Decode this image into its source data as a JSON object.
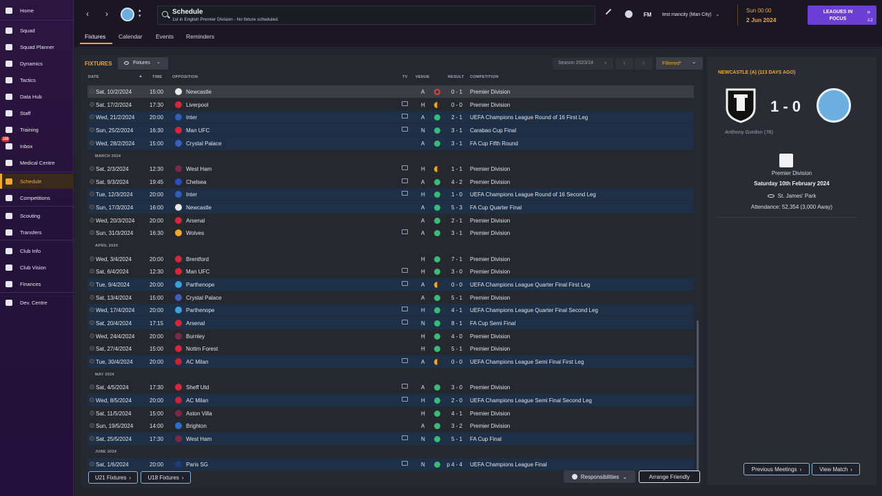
{
  "sidebar": {
    "items": [
      {
        "label": "Home",
        "icon": "home-icon"
      },
      {
        "label": "Squad",
        "icon": "squad-icon"
      },
      {
        "label": "Squad Planner",
        "icon": "clipboard-icon"
      },
      {
        "label": "Dynamics",
        "icon": "dynamics-icon"
      },
      {
        "label": "Tactics",
        "icon": "tactics-icon"
      },
      {
        "label": "Data Hub",
        "icon": "data-hub-icon"
      },
      {
        "label": "Staff",
        "icon": "staff-icon"
      },
      {
        "label": "Training",
        "icon": "training-icon"
      },
      {
        "label": "Inbox",
        "icon": "inbox-icon",
        "badge": "150"
      },
      {
        "label": "Medical Centre",
        "icon": "medical-icon"
      },
      {
        "label": "Schedule",
        "icon": "calendar-icon",
        "active": true
      },
      {
        "label": "Competitions",
        "icon": "trophy-icon"
      },
      {
        "label": "Scouting",
        "icon": "scouting-icon"
      },
      {
        "label": "Transfers",
        "icon": "transfers-icon"
      },
      {
        "label": "Club Info",
        "icon": "shield-icon"
      },
      {
        "label": "Club Vision",
        "icon": "vision-icon"
      },
      {
        "label": "Finances",
        "icon": "finances-icon"
      },
      {
        "label": "Dev. Centre",
        "icon": "dev-centre-icon"
      }
    ]
  },
  "header": {
    "title": "Schedule",
    "subtitle": "1st in English Premier Division - No fixture scheduled.",
    "fm_label": "FM",
    "manager": "test mancity (Man City)",
    "time": "Sun 00:00",
    "date": "2 Jun 2024",
    "focus_button": "LEAGUES IN FOCUS",
    "focus_count": "2"
  },
  "tabs": [
    "Fixtures",
    "Calendar",
    "Events",
    "Reminders"
  ],
  "fixtures": {
    "heading": "FIXTURES",
    "view_dropdown": "Fixtures",
    "season": "Season 2023/24",
    "filter": "Filtered*",
    "columns": {
      "date": "DATE",
      "time": "TIME",
      "opposition": "OPPOSITION",
      "tv": "TV",
      "venue": "VENUE",
      "result": "RESULT",
      "competition": "COMPETITION"
    },
    "months": {
      "march": "MARCH 2024",
      "april": "APRIL 2024",
      "may": "MAY 2024",
      "june": "JUNE 2024"
    },
    "rows": [
      {
        "date": "Sat, 10/2/2024",
        "time": "15:00",
        "opp": "Newcastle",
        "tv": false,
        "venue": "A",
        "res": "0 - 1",
        "comp": "Premier Division",
        "outcome": "loss",
        "crest": "#e8e8e8",
        "hl": "sel"
      },
      {
        "date": "Sat, 17/2/2024",
        "time": "17:30",
        "opp": "Liverpool",
        "tv": true,
        "venue": "H",
        "res": "0 - 0",
        "comp": "Premier Division",
        "outcome": "draw",
        "crest": "#d6263b",
        "hl": ""
      },
      {
        "date": "Wed, 21/2/2024",
        "time": "20:00",
        "opp": "Inter",
        "tv": true,
        "venue": "A",
        "res": "2 - 1",
        "comp": "UEFA Champions League Round of 16 First Leg",
        "outcome": "win",
        "crest": "#2f5fb8",
        "hl": "hl"
      },
      {
        "date": "Sun, 25/2/2024",
        "time": "16:30",
        "opp": "Man UFC",
        "tv": true,
        "venue": "N",
        "res": "3 - 1",
        "comp": "Carabao Cup Final",
        "outcome": "win",
        "crest": "#d6263b",
        "hl": "hl"
      },
      {
        "date": "Wed, 28/2/2024",
        "time": "15:00",
        "opp": "Crystal Palace",
        "tv": false,
        "venue": "A",
        "res": "3 - 1",
        "comp": "FA Cup Fifth Round",
        "outcome": "win",
        "crest": "#3d5fc2",
        "hl": "hl"
      },
      {
        "date": "Sat, 2/3/2024",
        "time": "12:30",
        "opp": "West Ham",
        "tv": true,
        "venue": "H",
        "res": "1 - 1",
        "comp": "Premier Division",
        "outcome": "draw",
        "crest": "#7a2a45",
        "hl": ""
      },
      {
        "date": "Sat, 9/3/2024",
        "time": "19:45",
        "opp": "Chelsea",
        "tv": true,
        "venue": "A",
        "res": "4 - 2",
        "comp": "Premier Division",
        "outcome": "win",
        "crest": "#2a4fbf",
        "hl": ""
      },
      {
        "date": "Tue, 12/3/2024",
        "time": "20:00",
        "opp": "Inter",
        "tv": true,
        "venue": "H",
        "res": "1 - 0",
        "comp": "UEFA Champions League Round of 16 Second Leg",
        "outcome": "win",
        "crest": "#2f5fb8",
        "hl": "hl"
      },
      {
        "date": "Sun, 17/3/2024",
        "time": "16:00",
        "opp": "Newcastle",
        "tv": false,
        "venue": "A",
        "res": "5 - 3",
        "comp": "FA Cup Quarter Final",
        "outcome": "win",
        "crest": "#e8e8e8",
        "hl": "hl"
      },
      {
        "date": "Wed, 20/3/2024",
        "time": "20:00",
        "opp": "Arsenal",
        "tv": false,
        "venue": "A",
        "res": "2 - 1",
        "comp": "Premier Division",
        "outcome": "win",
        "crest": "#d6263b",
        "hl": ""
      },
      {
        "date": "Sun, 31/3/2024",
        "time": "16:30",
        "opp": "Wolves",
        "tv": true,
        "venue": "A",
        "res": "3 - 1",
        "comp": "Premier Division",
        "outcome": "win",
        "crest": "#f0a829",
        "hl": ""
      },
      {
        "date": "Wed, 3/4/2024",
        "time": "20:00",
        "opp": "Brentford",
        "tv": false,
        "venue": "H",
        "res": "7 - 1",
        "comp": "Premier Division",
        "outcome": "win",
        "crest": "#d6263b",
        "hl": ""
      },
      {
        "date": "Sat, 6/4/2024",
        "time": "12:30",
        "opp": "Man UFC",
        "tv": true,
        "venue": "H",
        "res": "3 - 0",
        "comp": "Premier Division",
        "outcome": "win",
        "crest": "#d6263b",
        "hl": ""
      },
      {
        "date": "Tue, 9/4/2024",
        "time": "20:00",
        "opp": "Parthenope",
        "tv": true,
        "venue": "A",
        "res": "0 - 0",
        "comp": "UEFA Champions League Quarter Final First Leg",
        "outcome": "draw",
        "crest": "#3aa0e0",
        "hl": "hl"
      },
      {
        "date": "Sat, 13/4/2024",
        "time": "15:00",
        "opp": "Crystal Palace",
        "tv": false,
        "venue": "A",
        "res": "5 - 1",
        "comp": "Premier Division",
        "outcome": "win",
        "crest": "#3d5fc2",
        "hl": ""
      },
      {
        "date": "Wed, 17/4/2024",
        "time": "20:00",
        "opp": "Parthenope",
        "tv": true,
        "venue": "H",
        "res": "4 - 1",
        "comp": "UEFA Champions League Quarter Final Second Leg",
        "outcome": "win",
        "crest": "#3aa0e0",
        "hl": "hl"
      },
      {
        "date": "Sat, 20/4/2024",
        "time": "17:15",
        "opp": "Arsenal",
        "tv": true,
        "venue": "N",
        "res": "8 - 1",
        "comp": "FA Cup Semi Final",
        "outcome": "win",
        "crest": "#d6263b",
        "hl": "hl"
      },
      {
        "date": "Wed, 24/4/2024",
        "time": "20:00",
        "opp": "Burnley",
        "tv": false,
        "venue": "H",
        "res": "4 - 0",
        "comp": "Premier Division",
        "outcome": "win",
        "crest": "#7a2a45",
        "hl": ""
      },
      {
        "date": "Sat, 27/4/2024",
        "time": "15:00",
        "opp": "Nottm Forest",
        "tv": false,
        "venue": "H",
        "res": "5 - 1",
        "comp": "Premier Division",
        "outcome": "win",
        "crest": "#d6263b",
        "hl": ""
      },
      {
        "date": "Tue, 30/4/2024",
        "time": "20:00",
        "opp": "AC Milan",
        "tv": true,
        "venue": "A",
        "res": "0 - 0",
        "comp": "UEFA Champions League Semi Final First Leg",
        "outcome": "draw",
        "crest": "#c8242b",
        "hl": "hl"
      },
      {
        "date": "Sat, 4/5/2024",
        "time": "17:30",
        "opp": "Sheff Utd",
        "tv": true,
        "venue": "A",
        "res": "3 - 0",
        "comp": "Premier Division",
        "outcome": "win",
        "crest": "#d6263b",
        "hl": ""
      },
      {
        "date": "Wed, 8/5/2024",
        "time": "20:00",
        "opp": "AC Milan",
        "tv": true,
        "venue": "H",
        "res": "2 - 0",
        "comp": "UEFA Champions League Semi Final Second Leg",
        "outcome": "win",
        "crest": "#c8242b",
        "hl": "hl"
      },
      {
        "date": "Sat, 11/5/2024",
        "time": "15:00",
        "opp": "Aston Villa",
        "tv": false,
        "venue": "H",
        "res": "4 - 1",
        "comp": "Premier Division",
        "outcome": "win",
        "crest": "#7a2a45",
        "hl": ""
      },
      {
        "date": "Sun, 19/5/2024",
        "time": "14:00",
        "opp": "Brighton",
        "tv": false,
        "venue": "A",
        "res": "3 - 2",
        "comp": "Premier Division",
        "outcome": "win",
        "crest": "#2a6fd0",
        "hl": ""
      },
      {
        "date": "Sat, 25/5/2024",
        "time": "17:30",
        "opp": "West Ham",
        "tv": true,
        "venue": "N",
        "res": "5 - 1",
        "comp": "FA Cup Final",
        "outcome": "win",
        "crest": "#7a2a45",
        "hl": "hl"
      },
      {
        "date": "Sat, 1/6/2024",
        "time": "20:00",
        "opp": "Paris SG",
        "tv": true,
        "venue": "N",
        "res": "p 4 - 4",
        "comp": "UEFA Champions League Final",
        "outcome": "win",
        "crest": "#1f3a7a",
        "hl": "hl"
      }
    ],
    "buttons": {
      "u21": "U21 Fixtures",
      "u18": "U18 Fixtures",
      "responsibilities": "Responsibilities",
      "arrange": "Arrange Friendly"
    }
  },
  "match": {
    "heading": "NEWCASTLE (A) (113 DAYS AGO)",
    "score": "1 - 0",
    "scorer": "Anthony Gordon (76)",
    "competition": "Premier Division",
    "date": "Saturday 10th February 2024",
    "stadium": "St. James' Park",
    "attendance": "Attendance: 52,354 (3,000 Away)",
    "prev_button": "Previous Meetings",
    "view_button": "View Match"
  },
  "colors": {
    "accent": "#f0a829",
    "win": "#3cb878",
    "loss": "#d9443c",
    "draw": "#f0a829"
  }
}
